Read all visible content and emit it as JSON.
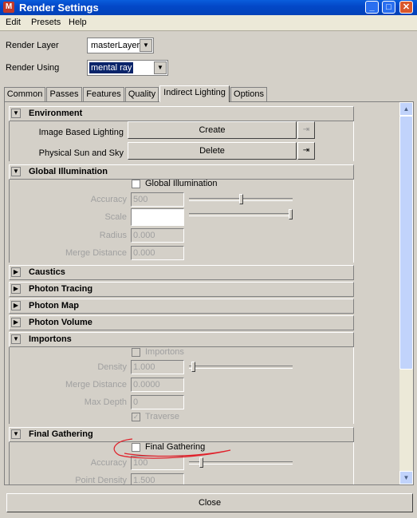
{
  "window": {
    "title": "Render Settings",
    "app_icon": "maya-logo-icon"
  },
  "window_controls": {
    "minimize": "_",
    "maximize": "□",
    "close": "✕"
  },
  "menu": [
    "Edit",
    "Presets",
    "Help"
  ],
  "render_layer": {
    "label": "Render Layer",
    "value": "masterLayer"
  },
  "render_using": {
    "label": "Render Using",
    "value": "mental ray"
  },
  "tabs": [
    "Common",
    "Passes",
    "Features",
    "Quality",
    "Indirect Lighting",
    "Options"
  ],
  "active_tab": "Indirect Lighting",
  "sections": {
    "environment": {
      "title": "Environment",
      "ibl_label": "Image Based Lighting",
      "ibl_button": "Create",
      "sun_label": "Physical Sun and Sky",
      "sun_button": "Delete"
    },
    "gi": {
      "title": "Global Illumination",
      "checkbox_label": "Global Illumination",
      "accuracy_label": "Accuracy",
      "accuracy_value": "500",
      "accuracy_slider": 0.5,
      "scale_label": "Scale",
      "scale_slider": 1.0,
      "radius_label": "Radius",
      "radius_value": "0.000",
      "merge_label": "Merge Distance",
      "merge_value": "0.000"
    },
    "caustics": {
      "title": "Caustics"
    },
    "photon_tracing": {
      "title": "Photon Tracing"
    },
    "photon_map": {
      "title": "Photon Map"
    },
    "photon_volume": {
      "title": "Photon Volume"
    },
    "importons": {
      "title": "Importons",
      "checkbox_label": "Importons",
      "density_label": "Density",
      "density_value": "1.000",
      "density_slider": 0.02,
      "merge_label": "Merge Distance",
      "merge_value": "0.0000",
      "depth_label": "Max Depth",
      "depth_value": "0",
      "traverse_label": "Traverse"
    },
    "fg": {
      "title": "Final Gathering",
      "checkbox_label": "Final Gathering",
      "accuracy_label": "Accuracy",
      "accuracy_value": "100",
      "accuracy_slider": 0.1,
      "point_density_label": "Point Density",
      "point_density_value": "1.500"
    }
  },
  "close_button": "Close",
  "colors": {
    "titlebar": "#0348c8",
    "annotation": "#e0202a"
  }
}
